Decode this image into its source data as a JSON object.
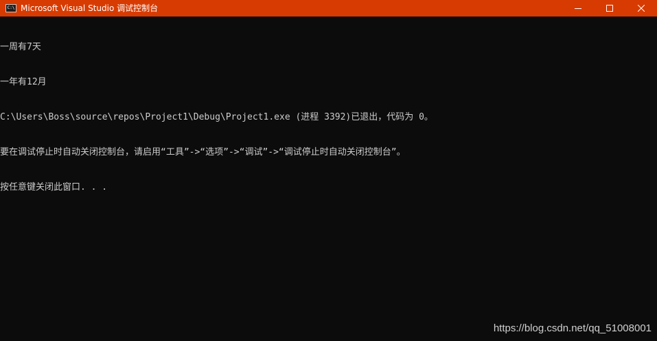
{
  "window": {
    "title": "Microsoft Visual Studio 调试控制台",
    "icon": "console-icon",
    "icon_text": "C:\\",
    "controls": {
      "minimize": "minimize-icon",
      "maximize": "maximize-icon",
      "close": "close-icon"
    },
    "accent_color": "#d83b01",
    "background_color": "#0c0c0c",
    "text_color": "#cccccc"
  },
  "console": {
    "lines": [
      "一周有7天",
      "一年有12月",
      "C:\\Users\\Boss\\source\\repos\\Project1\\Debug\\Project1.exe (进程 3392)已退出，代码为 0。",
      "要在调试停止时自动关闭控制台，请启用“工具”->“选项”->“调试”->“调试停止时自动关闭控制台”。",
      "按任意键关闭此窗口. . ."
    ]
  },
  "watermark": {
    "text": "https://blog.csdn.net/qq_51008001"
  }
}
